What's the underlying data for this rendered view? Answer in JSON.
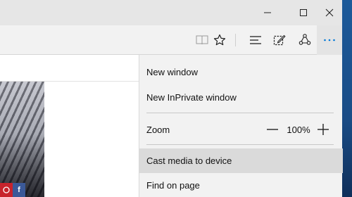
{
  "window": {
    "controls": {
      "minimize_icon": "minimize-icon",
      "maximize_icon": "maximize-icon",
      "close_icon": "close-icon"
    }
  },
  "toolbar": {
    "icons": [
      "reading-view-icon",
      "favorites-star-icon",
      "hub-icon",
      "web-note-icon",
      "share-icon",
      "more-actions-icon"
    ],
    "accent": "#0078d7"
  },
  "menu": {
    "new_window": "New window",
    "new_inprivate_window": "New InPrivate window",
    "zoom_label": "Zoom",
    "zoom_value": "100%",
    "zoom_out_symbol": "—",
    "zoom_in_symbol": "+",
    "cast_media": "Cast media to device",
    "find_on_page": "Find on page"
  },
  "page": {
    "social_icons": [
      "pinterest-icon",
      "facebook-icon"
    ],
    "facebook_letter": "f"
  }
}
